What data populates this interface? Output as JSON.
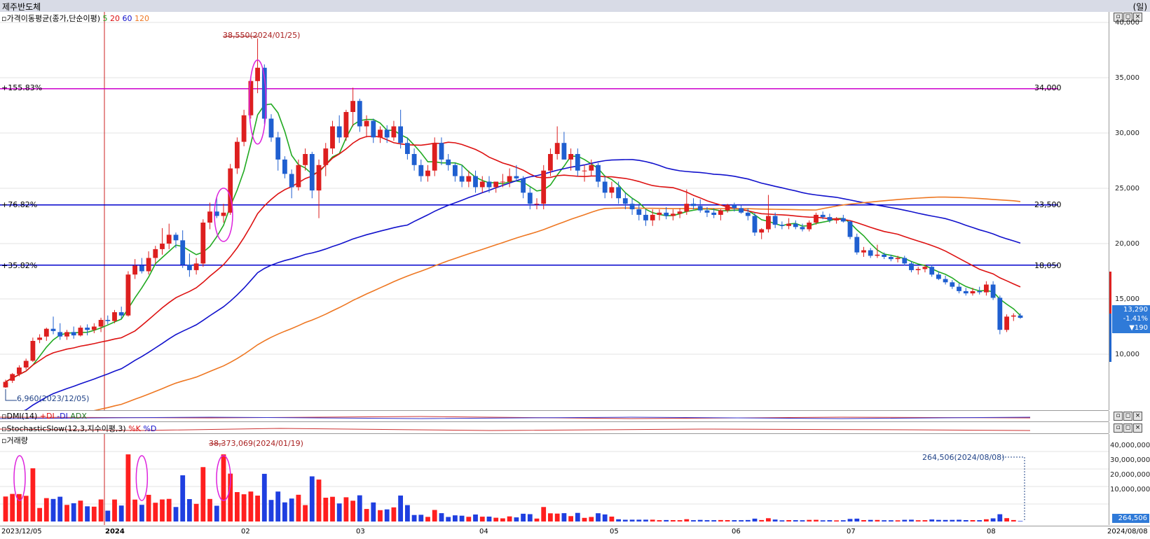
{
  "window": {
    "title": "제주반도체",
    "period_unit": "(일)"
  },
  "price_panel": {
    "legend_prefix": "가격이동평균(종가,단순이평)",
    "ma_periods": [
      "5",
      "20",
      "60",
      "120"
    ],
    "ma_colors": [
      "#22aa22",
      "#dd1111",
      "#1111cc",
      "#ee7722"
    ],
    "y_ticks": [
      "40,000",
      "35,000",
      "30,000",
      "25,000",
      "20,000",
      "15,000",
      "10,000"
    ],
    "high_annotation": "38,550(2024/01/25)",
    "low_annotation": "6,960(2023/12/05)",
    "levels": [
      {
        "pct": "+155.83%",
        "price": "34,000",
        "color": "#cc00cc"
      },
      {
        "pct": "+76.82%",
        "price": "23,500",
        "color": "#0000cc"
      },
      {
        "pct": "+35.82%",
        "price": "18,050",
        "color": "#0000cc"
      }
    ],
    "current": {
      "price": "13,290",
      "change_pct": "-1.41%",
      "change": "▼190"
    }
  },
  "dmi_panel": {
    "label": "DMI(14)",
    "lines": [
      "+DI",
      "-DI",
      "ADX"
    ]
  },
  "stoch_panel": {
    "label": "StochasticSlow(12,3,지수이평,3)",
    "lines": [
      "%K",
      "%D"
    ]
  },
  "volume_panel": {
    "label": "거래량",
    "y_ticks": [
      "40,000,000",
      "30,000,000",
      "20,000,000",
      "10,000,000"
    ],
    "peak_annotation": "38,373,069(2024/01/19)",
    "last_annotation": "264,506(2024/08/08)",
    "current": "264,506"
  },
  "x_axis": {
    "labels": [
      "2023/12/05",
      "2024",
      "02",
      "03",
      "04",
      "05",
      "06",
      "07",
      "08",
      "2024/08/08"
    ]
  },
  "buttons": {
    "expand": "▫",
    "restore": "◻",
    "close": "×"
  },
  "chart_data": {
    "type": "candlestick",
    "ylim": [
      6000,
      41000
    ],
    "ohlc": [
      [
        7000,
        7700,
        6960,
        7500
      ],
      [
        7600,
        8300,
        7400,
        8200
      ],
      [
        8200,
        9000,
        8000,
        8800
      ],
      [
        8800,
        9600,
        8600,
        9400
      ],
      [
        9400,
        11500,
        9300,
        11200
      ],
      [
        11300,
        11800,
        11000,
        11500
      ],
      [
        11600,
        12400,
        11200,
        12300
      ],
      [
        12300,
        13400,
        11800,
        12100
      ],
      [
        12000,
        12800,
        11300,
        11600
      ],
      [
        11600,
        12200,
        11300,
        12000
      ],
      [
        12000,
        12500,
        11400,
        11700
      ],
      [
        11700,
        12600,
        11600,
        12400
      ],
      [
        12400,
        12700,
        11700,
        12200
      ],
      [
        12200,
        12800,
        11900,
        12500
      ],
      [
        12500,
        13300,
        12000,
        13100
      ],
      [
        13100,
        13500,
        12700,
        13000
      ],
      [
        13000,
        14000,
        12800,
        13800
      ],
      [
        13800,
        14300,
        13200,
        13500
      ],
      [
        13500,
        17500,
        13400,
        17200
      ],
      [
        17200,
        18600,
        16800,
        18000
      ],
      [
        18000,
        18700,
        17300,
        17500
      ],
      [
        17500,
        19300,
        17200,
        18700
      ],
      [
        18700,
        19800,
        18200,
        19500
      ],
      [
        19500,
        21400,
        19000,
        20000
      ],
      [
        20000,
        21800,
        19500,
        20800
      ],
      [
        20800,
        21000,
        19600,
        20300
      ],
      [
        20300,
        21200,
        17800,
        18100
      ],
      [
        18100,
        19100,
        17000,
        17600
      ],
      [
        17600,
        18700,
        17200,
        18200
      ],
      [
        18200,
        22200,
        17900,
        21900
      ],
      [
        21900,
        23700,
        21300,
        22900
      ],
      [
        22900,
        24200,
        22300,
        22500
      ],
      [
        22500,
        23600,
        21900,
        22800
      ],
      [
        22800,
        27200,
        22600,
        26800
      ],
      [
        26800,
        29600,
        26300,
        29200
      ],
      [
        29200,
        32100,
        28800,
        31600
      ],
      [
        31600,
        35100,
        31300,
        34700
      ],
      [
        34700,
        38550,
        33600,
        35900
      ],
      [
        35900,
        36200,
        30800,
        31300
      ],
      [
        31300,
        31700,
        29200,
        29600
      ],
      [
        29600,
        30100,
        26600,
        27600
      ],
      [
        27600,
        27900,
        25900,
        26300
      ],
      [
        26300,
        26700,
        24100,
        25100
      ],
      [
        25100,
        27600,
        24800,
        27100
      ],
      [
        27100,
        28600,
        26600,
        28100
      ],
      [
        28100,
        28300,
        24100,
        24800
      ],
      [
        24800,
        27600,
        22300,
        27100
      ],
      [
        27100,
        29100,
        26100,
        28600
      ],
      [
        28600,
        31100,
        28100,
        30600
      ],
      [
        30600,
        31600,
        29100,
        29600
      ],
      [
        29600,
        32100,
        29300,
        31900
      ],
      [
        31900,
        34100,
        30600,
        32900
      ],
      [
        32900,
        33100,
        30100,
        30600
      ],
      [
        30600,
        31600,
        29600,
        31100
      ],
      [
        31100,
        31300,
        29100,
        29600
      ],
      [
        29600,
        30600,
        29100,
        30300
      ],
      [
        30300,
        30700,
        29100,
        29600
      ],
      [
        29600,
        31100,
        29300,
        30600
      ],
      [
        30600,
        32100,
        28600,
        29100
      ],
      [
        29100,
        29600,
        27600,
        28100
      ],
      [
        28100,
        28600,
        26600,
        27100
      ],
      [
        27100,
        27600,
        25600,
        26100
      ],
      [
        26100,
        27100,
        25600,
        26600
      ],
      [
        26600,
        29600,
        26100,
        29100
      ],
      [
        29100,
        29600,
        27100,
        27600
      ],
      [
        27600,
        28100,
        26600,
        27100
      ],
      [
        27100,
        27300,
        25600,
        26100
      ],
      [
        26100,
        27100,
        25100,
        25600
      ],
      [
        25600,
        26600,
        25100,
        26100
      ],
      [
        26100,
        26600,
        24600,
        25100
      ],
      [
        25100,
        26100,
        24600,
        25600
      ],
      [
        25600,
        26100,
        24600,
        25100
      ],
      [
        25100,
        25600,
        24600,
        25600
      ],
      [
        25600,
        26300,
        25100,
        25600
      ],
      [
        25600,
        26800,
        25100,
        26100
      ],
      [
        26100,
        27100,
        25600,
        25900
      ],
      [
        25900,
        26100,
        24100,
        24600
      ],
      [
        24600,
        25100,
        23100,
        23600
      ],
      [
        23600,
        24100,
        23100,
        23600
      ],
      [
        23600,
        27100,
        23100,
        26600
      ],
      [
        26600,
        28600,
        26100,
        28100
      ],
      [
        28100,
        30600,
        27600,
        29100
      ],
      [
        29100,
        30100,
        27600,
        27600
      ],
      [
        27600,
        28600,
        26600,
        28100
      ],
      [
        28100,
        28600,
        26100,
        26600
      ],
      [
        26600,
        27100,
        25600,
        26600
      ],
      [
        26600,
        27600,
        26100,
        27100
      ],
      [
        27100,
        27300,
        25100,
        25600
      ],
      [
        25600,
        26100,
        24100,
        24600
      ],
      [
        24600,
        25600,
        24100,
        25100
      ],
      [
        25100,
        25600,
        23600,
        24100
      ],
      [
        24100,
        24600,
        23100,
        23600
      ],
      [
        23600,
        24100,
        22600,
        23100
      ],
      [
        23100,
        23600,
        22100,
        22600
      ],
      [
        22600,
        23100,
        21600,
        22100
      ],
      [
        22100,
        23100,
        21600,
        22600
      ],
      [
        22600,
        23100,
        22100,
        22800
      ],
      [
        22800,
        23300,
        22200,
        22500
      ],
      [
        22500,
        23100,
        22100,
        22700
      ],
      [
        22700,
        23200,
        22300,
        22900
      ],
      [
        22900,
        24900,
        22600,
        23600
      ],
      [
        23600,
        24100,
        23100,
        23400
      ],
      [
        23400,
        24000,
        22800,
        23000
      ],
      [
        23000,
        23300,
        22400,
        22800
      ],
      [
        22800,
        23200,
        22300,
        22600
      ],
      [
        22600,
        23100,
        22100,
        23000
      ],
      [
        23000,
        23600,
        22800,
        23500
      ],
      [
        23500,
        23700,
        22900,
        23200
      ],
      [
        23200,
        23500,
        22700,
        22800
      ],
      [
        22800,
        23200,
        22100,
        22500
      ],
      [
        22500,
        22800,
        20700,
        21000
      ],
      [
        21000,
        21400,
        20400,
        21300
      ],
      [
        21300,
        24400,
        21000,
        22500
      ],
      [
        22500,
        22800,
        21400,
        21700
      ],
      [
        21700,
        22000,
        21300,
        21600
      ],
      [
        21600,
        22300,
        21300,
        21800
      ],
      [
        21800,
        22100,
        21300,
        21500
      ],
      [
        21500,
        21800,
        21100,
        21300
      ],
      [
        21300,
        22100,
        21100,
        21900
      ],
      [
        21900,
        22800,
        21700,
        22600
      ],
      [
        22600,
        22900,
        22200,
        22400
      ],
      [
        22400,
        22700,
        21900,
        22100
      ],
      [
        22100,
        22400,
        21800,
        22300
      ],
      [
        22300,
        22600,
        21900,
        22000
      ],
      [
        22000,
        22100,
        20400,
        20600
      ],
      [
        20600,
        20900,
        19000,
        19200
      ],
      [
        19200,
        19700,
        18800,
        19400
      ],
      [
        19400,
        19600,
        18700,
        18900
      ],
      [
        18900,
        19900,
        18700,
        19000
      ],
      [
        19000,
        19200,
        18600,
        18800
      ],
      [
        18800,
        19000,
        18400,
        18600
      ],
      [
        18600,
        18900,
        18300,
        18700
      ],
      [
        18700,
        18900,
        18000,
        18200
      ],
      [
        18200,
        18400,
        17400,
        17600
      ],
      [
        17600,
        17900,
        17200,
        17700
      ],
      [
        17700,
        18100,
        17400,
        17900
      ],
      [
        17900,
        18100,
        17000,
        17200
      ],
      [
        17200,
        17500,
        16700,
        16800
      ],
      [
        16800,
        17100,
        16300,
        16500
      ],
      [
        16500,
        16700,
        15900,
        16100
      ],
      [
        16100,
        16400,
        15500,
        15700
      ],
      [
        15700,
        16000,
        15300,
        15500
      ],
      [
        15500,
        16000,
        15300,
        15700
      ],
      [
        15700,
        16100,
        15400,
        15600
      ],
      [
        15600,
        16600,
        15300,
        16300
      ],
      [
        16300,
        16600,
        14900,
        15100
      ],
      [
        15100,
        15300,
        11800,
        12200
      ],
      [
        12200,
        13600,
        12000,
        13400
      ],
      [
        13400,
        13700,
        13000,
        13500
      ],
      [
        13500,
        13700,
        13200,
        13290
      ]
    ],
    "volume_peak": 38373069,
    "volume_last": 264506
  }
}
